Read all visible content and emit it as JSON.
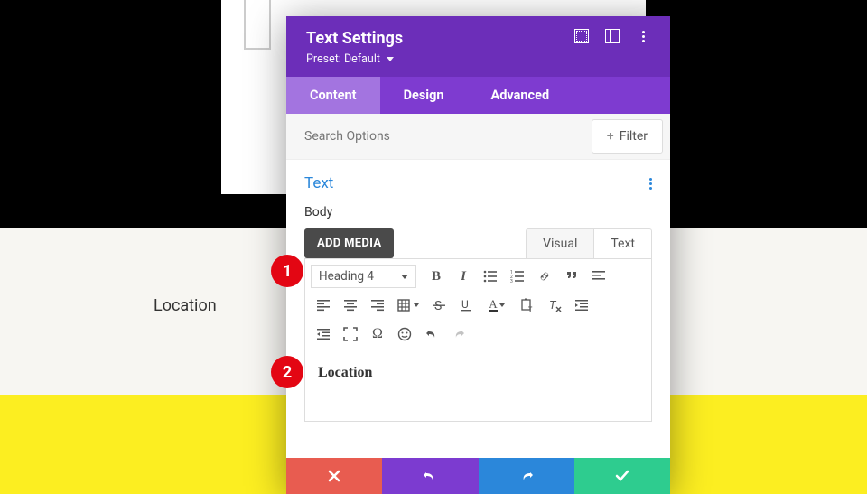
{
  "page": {
    "location_label": "Location"
  },
  "modal": {
    "title": "Text Settings",
    "preset_prefix": "Preset:",
    "preset_value": "Default"
  },
  "tabs": {
    "content": "Content",
    "design": "Design",
    "advanced": "Advanced"
  },
  "search": {
    "placeholder": "Search Options"
  },
  "filter": {
    "label": "Filter"
  },
  "section": {
    "title": "Text"
  },
  "body": {
    "label": "Body"
  },
  "media_btn": "ADD MEDIA",
  "editor_tabs": {
    "visual": "Visual",
    "text": "Text"
  },
  "format_select": "Heading 4",
  "toolbar": {
    "bold": "B",
    "italic": "I",
    "textcolor_letter": "A",
    "omega": "Ω",
    "smiley": "☺"
  },
  "editor_content": "Location",
  "annotations": {
    "n1": "1",
    "n2": "2"
  }
}
